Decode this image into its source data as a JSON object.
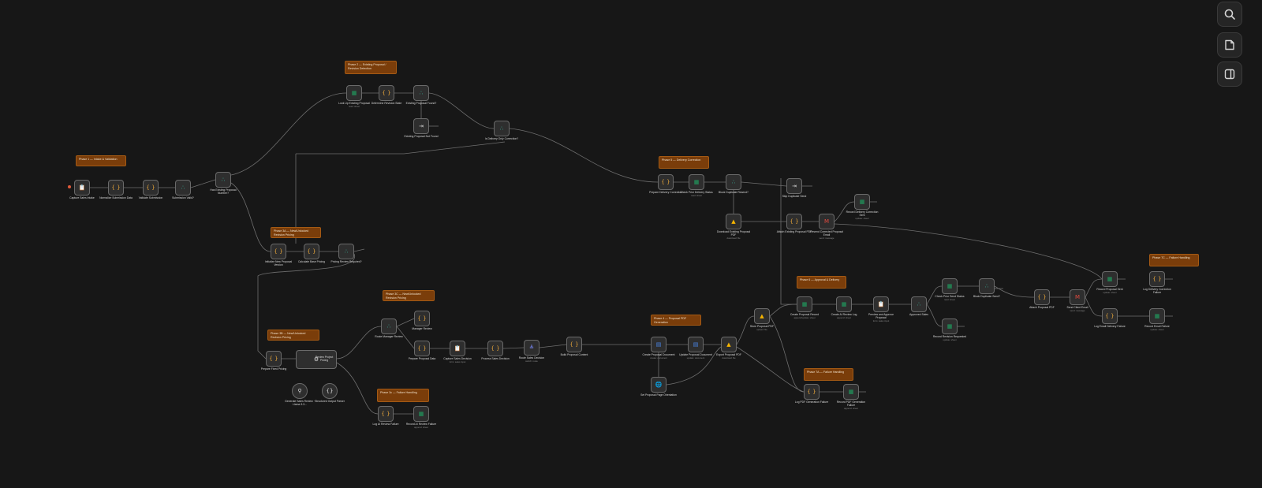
{
  "canvas": {
    "background": "#171717",
    "sticky_color": "#7a3d0a"
  },
  "stickies": [
    {
      "id": "s1",
      "text": "Phase 1 — Intake & Validation"
    },
    {
      "id": "s2",
      "text": "Phase 2 — Existing Proposal / Revision Detection"
    },
    {
      "id": "s3",
      "text": "Phase 3A — New/Unlocked Revision Pricing"
    },
    {
      "id": "s4",
      "text": "Phase 3B — New/Unlocked Revision Pricing"
    },
    {
      "id": "s5",
      "text": "Phase 3C — New/Unlocked Revision Pricing"
    },
    {
      "id": "s6",
      "text": "Phase 3c — Failure Handling"
    },
    {
      "id": "s7",
      "text": "Phase 4 — Proposal PDF Generation"
    },
    {
      "id": "s8",
      "text": "Phase 5 — Delivery Correction"
    },
    {
      "id": "s9",
      "text": "Phase 6 — Approval & Delivery"
    },
    {
      "id": "s10",
      "text": "Phase 7A — Failure Handling"
    },
    {
      "id": "s11",
      "text": "Phase 7C — Failure Handling"
    }
  ],
  "nodes": [
    {
      "id": "n1",
      "icon": "clipboard-icon",
      "label": "Capture Sales Intake",
      "sub": ""
    },
    {
      "id": "n2",
      "icon": "code-icon",
      "label": "Normalize Submission Data",
      "sub": ""
    },
    {
      "id": "n3",
      "icon": "code-icon",
      "label": "Validate Submission",
      "sub": ""
    },
    {
      "id": "n4",
      "icon": "if-icon",
      "label": "Submission Valid?",
      "sub": ""
    },
    {
      "id": "n5",
      "icon": "if-icon",
      "label": "Has Existing Proposal Number?",
      "sub": ""
    },
    {
      "id": "n6",
      "icon": "sheet-icon",
      "label": "Look Up Existing Proposal",
      "sub": "read: sheet"
    },
    {
      "id": "n7",
      "icon": "code-icon",
      "label": "Determine Revision State",
      "sub": ""
    },
    {
      "id": "n8",
      "icon": "if-icon",
      "label": "Existing Proposal Found?",
      "sub": ""
    },
    {
      "id": "n9",
      "icon": "noop-icon",
      "label": "Existing Proposal Not Found",
      "sub": ""
    },
    {
      "id": "n10",
      "icon": "if-icon",
      "label": "Is Delivery Only Correction?",
      "sub": ""
    },
    {
      "id": "n11",
      "icon": "code-icon",
      "label": "Initialize New Proposal Version",
      "sub": ""
    },
    {
      "id": "n12",
      "icon": "code-icon",
      "label": "Calculate Base Pricing",
      "sub": ""
    },
    {
      "id": "n13",
      "icon": "if-icon",
      "label": "Pricing Review Required?",
      "sub": ""
    },
    {
      "id": "n14",
      "icon": "code-icon",
      "label": "Prepare Fixed Pricing",
      "sub": ""
    },
    {
      "id": "n15",
      "icon": "ai-agent-icon",
      "label": "Review Project Pricing",
      "sub": ""
    },
    {
      "id": "n16",
      "icon": "model-icon",
      "label": "Generate Sales Review · Llama 3.3...",
      "sub": ""
    },
    {
      "id": "n17",
      "icon": "parser-icon",
      "label": "Structured Output Parser",
      "sub": ""
    },
    {
      "id": "n18",
      "icon": "if-icon",
      "label": "Route Manager Review",
      "sub": ""
    },
    {
      "id": "n19",
      "icon": "code-icon",
      "label": "Manager Review",
      "sub": ""
    },
    {
      "id": "n20",
      "icon": "code-icon",
      "label": "Prepare Proposal Data",
      "sub": ""
    },
    {
      "id": "n21",
      "icon": "clipboard-icon",
      "label": "Capture Sales Decision",
      "sub": "form: sales input"
    },
    {
      "id": "n22",
      "icon": "code-icon",
      "label": "Process Sales Decision",
      "sub": ""
    },
    {
      "id": "n23",
      "icon": "filter-icon",
      "label": "Route Sales Decision",
      "sub": "switch: route"
    },
    {
      "id": "n24",
      "icon": "code-icon",
      "label": "Build Proposal Content",
      "sub": ""
    },
    {
      "id": "n25",
      "icon": "code-icon",
      "label": "Log AI Review Failure",
      "sub": ""
    },
    {
      "id": "n26",
      "icon": "sheet-icon",
      "label": "Record AI Review Failure",
      "sub": "append: sheet"
    },
    {
      "id": "n27",
      "icon": "doc-icon",
      "label": "Create Proposal Document",
      "sub": "create: document"
    },
    {
      "id": "n28",
      "icon": "doc-icon",
      "label": "Update Proposal Document",
      "sub": "update: document"
    },
    {
      "id": "n29",
      "icon": "drive-icon",
      "label": "Export Proposal PDF",
      "sub": "download: file"
    },
    {
      "id": "n30",
      "icon": "web-icon",
      "label": "Set Proposal Page Orientation",
      "sub": ""
    },
    {
      "id": "n31",
      "icon": "drive-icon",
      "label": "Store Proposal PDF",
      "sub": "upload: file"
    },
    {
      "id": "n32",
      "icon": "code-icon",
      "label": "Prepare Delivery Correction",
      "sub": ""
    },
    {
      "id": "n33",
      "icon": "sheet-icon",
      "label": "Check Prior Delivery Status",
      "sub": "read: sheet"
    },
    {
      "id": "n34",
      "icon": "if-icon",
      "label": "Block Duplicate Resend?",
      "sub": ""
    },
    {
      "id": "n35",
      "icon": "drive-icon",
      "label": "Download Existing Proposal PDF",
      "sub": "download: file"
    },
    {
      "id": "n36",
      "icon": "noop-icon",
      "label": "Skip Duplicate Send",
      "sub": ""
    },
    {
      "id": "n37",
      "icon": "code-icon",
      "label": "Attach Existing Proposal PDF",
      "sub": ""
    },
    {
      "id": "n38",
      "icon": "gmail-icon",
      "label": "Resend Corrected Proposal Email",
      "sub": "send: message"
    },
    {
      "id": "n39",
      "icon": "sheet-icon",
      "label": "Record Delivery Correction Sent",
      "sub": "update: sheet"
    },
    {
      "id": "n40",
      "icon": "sheet-icon",
      "label": "Create Proposal Record",
      "sub": "append/update: sheet"
    },
    {
      "id": "n41",
      "icon": "sheet-icon",
      "label": "Create AI Review Log",
      "sub": "append: sheet"
    },
    {
      "id": "n42",
      "icon": "clipboard-icon",
      "label": "Preview and Approve Proposal",
      "sub": "form: sales input"
    },
    {
      "id": "n43",
      "icon": "if-icon",
      "label": "Approved Sales",
      "sub": ""
    },
    {
      "id": "n44",
      "icon": "sheet-icon",
      "label": "Check Prior Send Status",
      "sub": "read: sheet"
    },
    {
      "id": "n45",
      "icon": "if-icon",
      "label": "Block Duplicate Send?",
      "sub": ""
    },
    {
      "id": "n46",
      "icon": "sheet-icon",
      "label": "Record Revision Requested",
      "sub": "update: sheet"
    },
    {
      "id": "n47",
      "icon": "code-icon",
      "label": "Attach Proposal PDF",
      "sub": ""
    },
    {
      "id": "n48",
      "icon": "gmail-icon",
      "label": "Send Client Email",
      "sub": "send: message"
    },
    {
      "id": "n49",
      "icon": "sheet-icon",
      "label": "Record Proposal Sent",
      "sub": "update: sheet"
    },
    {
      "id": "n50",
      "icon": "code-icon",
      "label": "Log Email Delivery Failure",
      "sub": ""
    },
    {
      "id": "n51",
      "icon": "code-icon",
      "label": "Log Delivery Correction Failure",
      "sub": ""
    },
    {
      "id": "n52",
      "icon": "sheet-icon",
      "label": "Record Email Failure",
      "sub": "update: sheet"
    },
    {
      "id": "n53",
      "icon": "code-icon",
      "label": "Log PDF Generation Failure",
      "sub": ""
    },
    {
      "id": "n54",
      "icon": "sheet-icon",
      "label": "Record PDF Generation Failure",
      "sub": "append: sheet"
    }
  ],
  "right_toolbar": [
    {
      "id": "search",
      "icon": "search-icon"
    },
    {
      "id": "notes",
      "icon": "sticky-note-icon"
    },
    {
      "id": "panel",
      "icon": "panel-toggle-icon"
    }
  ]
}
